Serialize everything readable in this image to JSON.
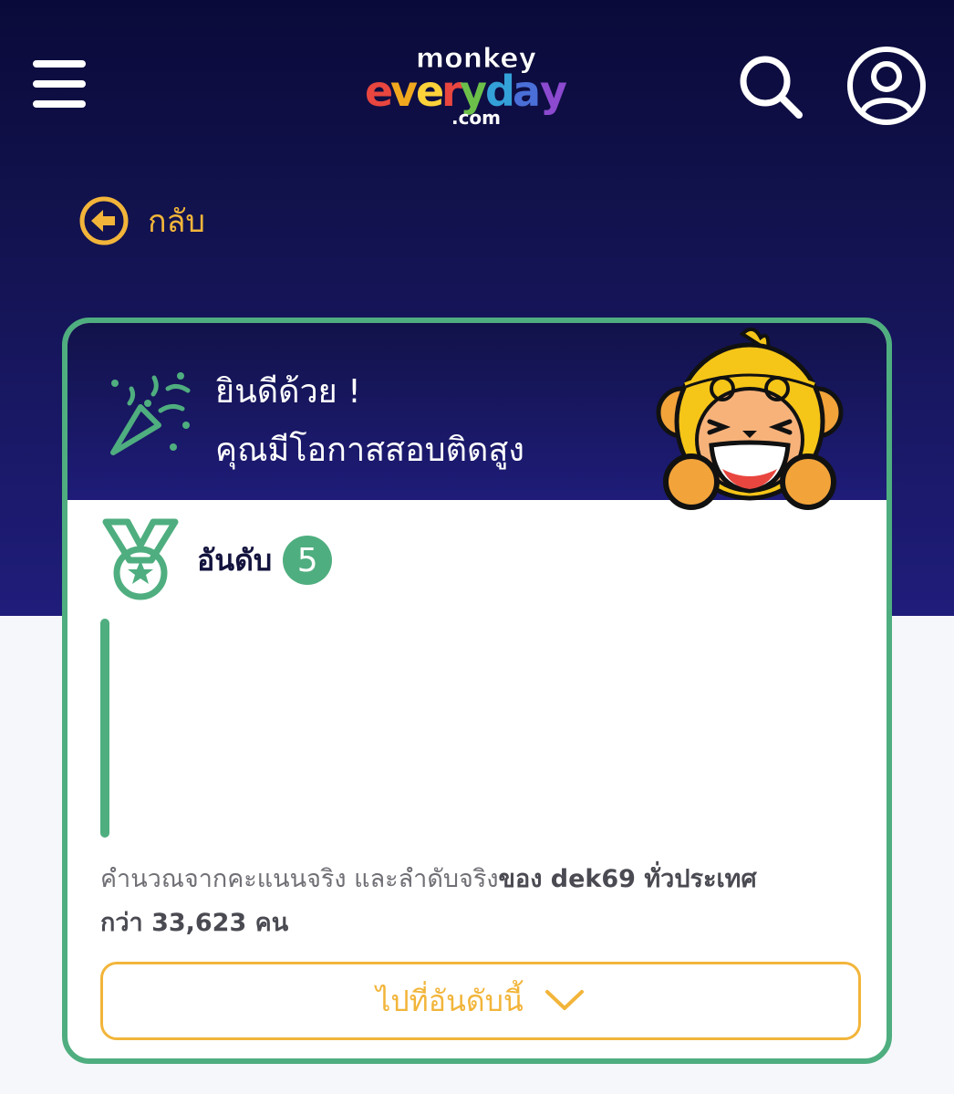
{
  "header": {
    "logo_top": "monkey",
    "logo_main": "everyday",
    "logo_domain": ".com",
    "menu_icon": "hamburger-menu-icon",
    "search_icon": "search-icon",
    "account_icon": "user-account-icon"
  },
  "back": {
    "label": "กลับ",
    "icon": "arrow-left-circle-icon"
  },
  "result_card": {
    "title_line1": "ยินดีด้วย !",
    "title_line2": "คุณมีโอกาสสอบติดสูง",
    "rank_label": "อันดับ",
    "rank_number": "5",
    "note_plain": "คำนวณจากคะแนนจริง และลำดับจริง",
    "note_bold1": "ของ dek69 ทั่วประเทศ",
    "note_bold2": "กว่า 33,623 คน",
    "goto_button": "ไปที่อันดับนี้"
  },
  "colors": {
    "accent_green": "#4fae7f",
    "accent_yellow": "#f2b53a",
    "navy": "#12124a"
  }
}
